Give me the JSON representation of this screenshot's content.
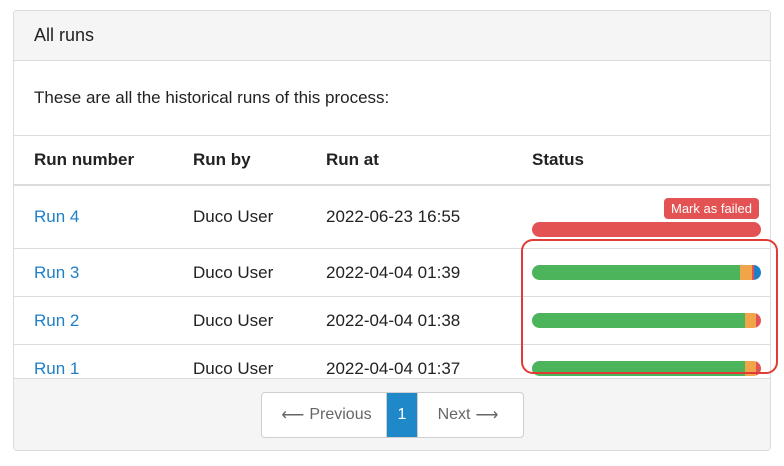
{
  "panel": {
    "title": "All runs",
    "intro": "These are all the historical runs of this process:"
  },
  "table": {
    "headers": [
      "Run number",
      "Run by",
      "Run at",
      "Status"
    ],
    "rows": [
      {
        "run": "Run 4",
        "by": "Duco User",
        "at": "2022-06-23 16:55",
        "action": "Mark as failed"
      },
      {
        "run": "Run 3",
        "by": "Duco User",
        "at": "2022-04-04 01:39"
      },
      {
        "run": "Run 2",
        "by": "Duco User",
        "at": "2022-04-04 01:38"
      },
      {
        "run": "Run 1",
        "by": "Duco User",
        "at": "2022-04-04 01:37"
      }
    ]
  },
  "status_bars": {
    "run4": [
      {
        "color": "#e45353",
        "fraction": 1.0
      }
    ],
    "run3": [
      {
        "color": "#4cb45b",
        "fraction": 0.91
      },
      {
        "color": "#f0a54a",
        "fraction": 0.05
      },
      {
        "color": "#e45353",
        "fraction": 0.01
      },
      {
        "color": "#1f7fc6",
        "fraction": 0.03
      }
    ],
    "run2": [
      {
        "color": "#4cb45b",
        "fraction": 0.93
      },
      {
        "color": "#f0a54a",
        "fraction": 0.05
      },
      {
        "color": "#e45353",
        "fraction": 0.02
      }
    ],
    "run1": [
      {
        "color": "#4cb45b",
        "fraction": 0.93
      },
      {
        "color": "#f0a54a",
        "fraction": 0.05
      },
      {
        "color": "#e45353",
        "fraction": 0.02
      }
    ]
  },
  "pagination": {
    "previous": "Previous",
    "current": "1",
    "next": "Next",
    "left_arrow": "⟵",
    "right_arrow": "⟶"
  },
  "colors": {
    "link": "#1f7fc6",
    "danger": "#e45353",
    "success": "#4cb45b",
    "warning": "#f0a54a",
    "info": "#1f7fc6",
    "active_page": "#1f88c9",
    "highlight": "#e03b34"
  }
}
